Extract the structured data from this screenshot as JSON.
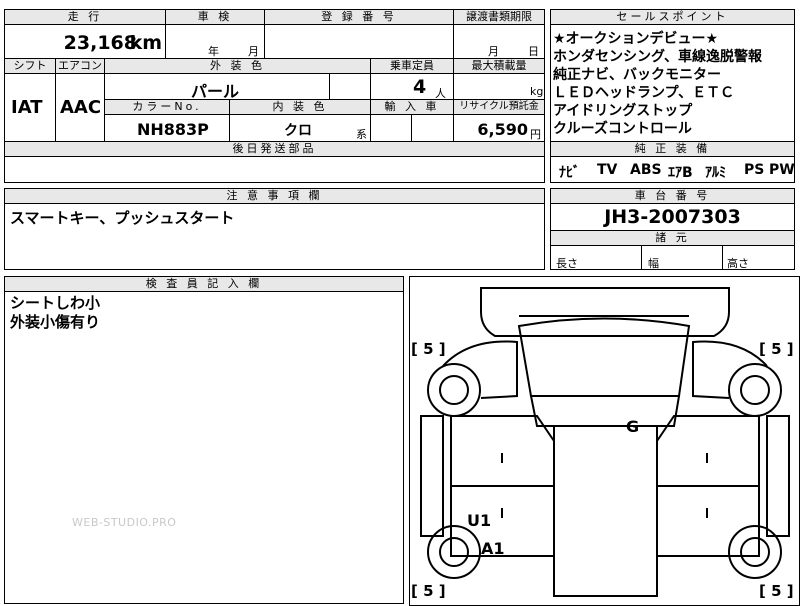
{
  "top": {
    "mileage_label": "走 行",
    "mileage_value": "23,168",
    "mileage_unit": "km",
    "shaken_label": "車 検",
    "shaken_year": "年",
    "shaken_month": "月",
    "reg_label": "登 録 番 号",
    "transfer_label": "譲渡書類期限",
    "transfer_month": "月",
    "transfer_day": "日",
    "shift_label": "シフト",
    "ac_label": "エアコン",
    "color_label": "外 装 色",
    "seats_label": "乗車定員",
    "load_label": "最大積載量",
    "shift_value": "IAT",
    "ac_value": "AAC",
    "color_value": "パール",
    "seats_value": "4",
    "seats_unit": "人",
    "load_unit": "kg",
    "color_no_label": "カラーNo.",
    "interior_label": "内 装 色",
    "import_label": "輸 入 車",
    "recycle_label": "リサイクル預託金",
    "color_no_value": "NH883P",
    "interior_value": "クロ",
    "interior_suffix": "系",
    "recycle_value": "6,590",
    "recycle_unit": "円",
    "later_parts_label": "後日発送部品"
  },
  "selling": {
    "label": "セールスポイント",
    "lines": [
      "★オークションデビュー★",
      "ホンダセンシング、車線逸脱警報",
      "純正ナビ、バックモニター",
      "ＬＥＤヘッドランプ、ＥＴＣ",
      "アイドリングストップ",
      "クルーズコントロール"
    ]
  },
  "equipment": {
    "label": "純 正 装 備",
    "items": [
      "ﾅﾋﾞ",
      "TV",
      "ABS",
      "ｴｱB",
      "ｱﾙﾐ",
      "PS",
      "PW"
    ]
  },
  "notes": {
    "label": "注 意 事 項 欄",
    "text": "スマートキー、プッシュスタート"
  },
  "chassis": {
    "label": "車 台 番 号",
    "value": "JH3-2007303"
  },
  "dims": {
    "label": "諸 元",
    "length": "長さ",
    "width": "幅",
    "height": "高さ"
  },
  "inspector": {
    "label": "検 査 員 記 入 欄",
    "lines": [
      "シートしわ小",
      "外装小傷有り"
    ]
  },
  "watermark": "WEB-STUDIO.PRO",
  "diagram": {
    "tire_tl": "[ 5 ]",
    "tire_tr": "[ 5 ]",
    "tire_bl": "[ 5 ]",
    "tire_br": "[ 5 ]",
    "mark_g": "G",
    "mark_u1": "U1",
    "mark_a1": "A1"
  }
}
